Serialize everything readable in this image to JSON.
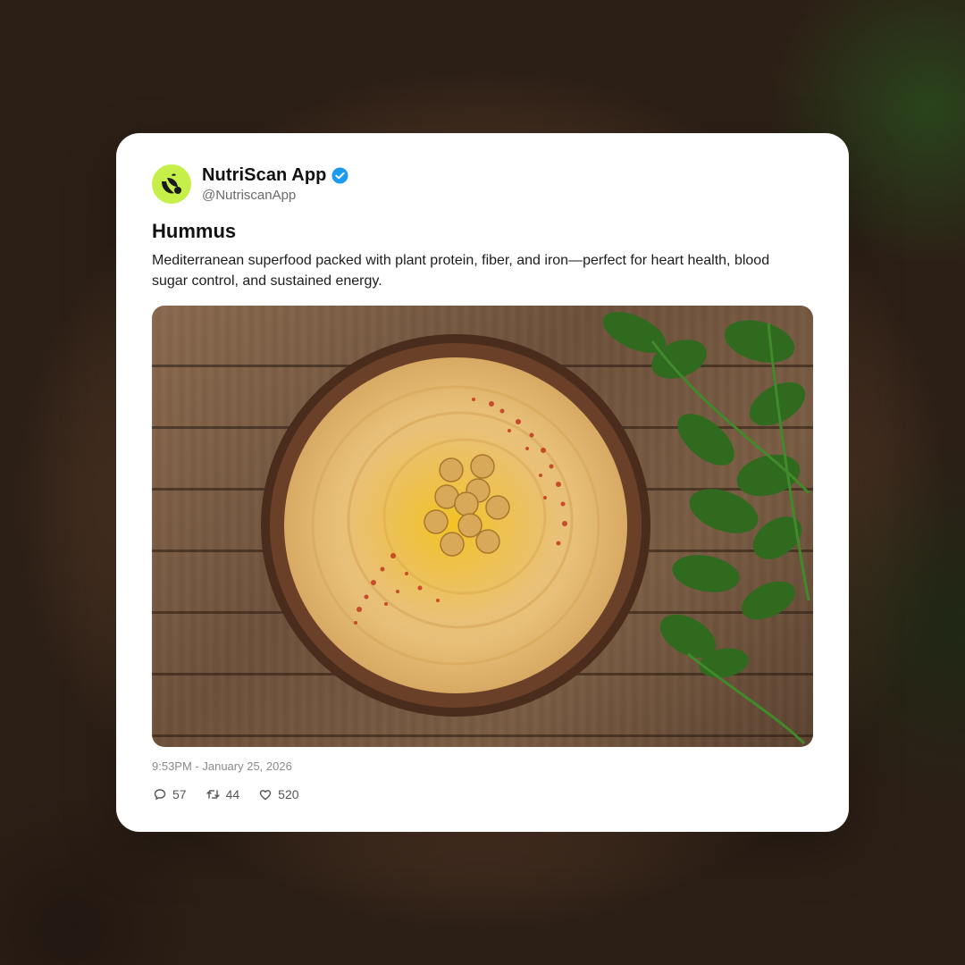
{
  "post": {
    "author": {
      "display_name": "NutriScan App",
      "handle": "@NutriscanApp",
      "verified": true,
      "avatar_color": "#c6ef4a"
    },
    "title": "Hummus",
    "description": "Mediterranean superfood packed with plant protein, fiber, and iron—perfect for heart health, blood sugar control, and sustained energy.",
    "image": {
      "subject": "hummus-bowl-photo",
      "icon": "hummus-photo"
    },
    "timestamp": "9:53PM - January 25, 2026",
    "stats": {
      "replies": "57",
      "reposts": "44",
      "likes": "520"
    }
  },
  "icons": {
    "verified": "verified-badge-icon",
    "reply": "comment-icon",
    "repost": "repost-icon",
    "like": "heart-icon"
  },
  "colors": {
    "verified_blue": "#1d9bf0",
    "card_bg": "#ffffff",
    "muted_text": "#6b6b6b"
  }
}
